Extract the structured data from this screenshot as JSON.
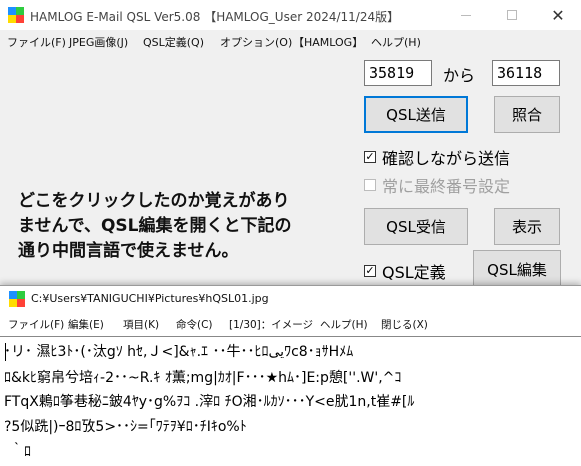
{
  "hamlog": {
    "title": "HAMLOG E-Mail QSL Ver5.08 【HAMLOG_User 2024/11/24版】",
    "window_controls": {
      "minimize": "—",
      "maximize": "☐",
      "close": "✕"
    },
    "menu": [
      "ファイル(F)",
      "JPEG画像(J)",
      "QSL定義(Q)",
      "オプション(O)",
      "【HAMLOG】",
      "ヘルプ(H)"
    ],
    "range": {
      "from_value": "35819",
      "from_label": "から",
      "to_value": "36118"
    },
    "buttons": {
      "qsl_send": "QSL送信",
      "verify": "照合",
      "qsl_receive": "QSL受信",
      "display": "表示",
      "qsl_edit": "QSL編集"
    },
    "checkboxes": {
      "confirm_send": {
        "label": "確認しながら送信",
        "checked": true
      },
      "last_number": {
        "label": "常に最終番号設定",
        "checked": false
      },
      "qsl_definition": {
        "label": "QSL定義",
        "checked": true
      }
    },
    "note_lines": [
      "どこをクリックしたのか覚えがあり",
      "ませんで、QSL編集を開くと下記の",
      "通り中間言語で使えません。"
    ]
  },
  "viewer": {
    "title": "C:¥Users¥TANIGUCHI¥Pictures¥hQSL01.jpg",
    "menu": [
      "ファイル(F)",
      "編集(E)",
      "項目(K)",
      "命令(C)",
      "[1/30]：イメージ",
      "ヘルプ(H)",
      "閉じる(X)"
    ],
    "lines": [
      "･リ･ 濕ﾋ3ﾄ･(･汰gｿ hｾ,Ｊ<]&ｬ.ｴ  ･･牛･･ﾋﾛییﾜc8･ｮｻHﾒﾑ",
      "ﾛ&kﾋ窮帛兮培ｨ-2･･~R.ｷ ｵ薫;mg|ｶｵ|F･･･★hﾑ･]E:p憩[''.W',^ｺ",
      "FTqX鶫ﾛ筝巷秘ﾆ鈹4ﾔy･g%ｦｺ .滓ﾛ ﾁO湘･ﾙｶｿ･･･Y<e肬1n,t崔#[ﾙ",
      "?5似跣|)ｰ8ﾛ攷5>･･ｼ=｢ﾜﾃｦ¥ﾛ･ﾁIｷo%ﾄ",
      "｀ﾛ"
    ]
  }
}
